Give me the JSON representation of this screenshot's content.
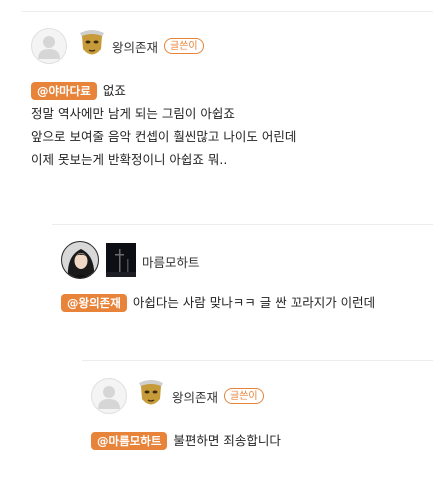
{
  "comments": [
    {
      "author": "왕의존재",
      "writer_tag": "글쓴이",
      "mention": "@야마다료",
      "lines": [
        "없죠",
        "정말 역사에만 남게 되는 그림이 아쉽죠",
        "앞으로 보여줄 음악 컨셉이 훨씬많고 나이도 어린데",
        "이제 못보는게 반확정이니 아쉽죠 뭐.."
      ]
    },
    {
      "author": "마름모하트",
      "mention": "@왕의존재",
      "lines": [
        "아쉽다는 사람 맞나ㅋㅋ 글 싼 꼬라지가 이런데"
      ]
    },
    {
      "author": "왕의존재",
      "writer_tag": "글쓴이",
      "mention": "@마름모하트",
      "lines": [
        "불편하면 죄송합니다"
      ]
    }
  ],
  "colors": {
    "accent": "#e8833a"
  }
}
